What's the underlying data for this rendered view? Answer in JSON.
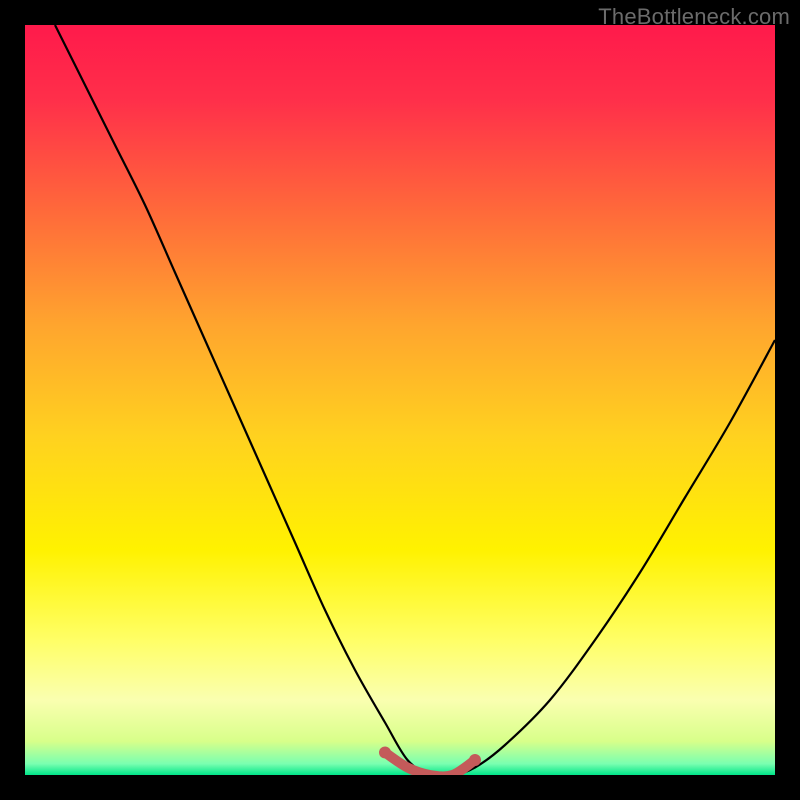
{
  "watermark": "TheBottleneck.com",
  "chart_data": {
    "type": "line",
    "title": "",
    "xlabel": "",
    "ylabel": "",
    "xlim": [
      0,
      100
    ],
    "ylim": [
      0,
      100
    ],
    "gradient_stops": [
      {
        "offset": 0.0,
        "color": "#ff1a4b"
      },
      {
        "offset": 0.1,
        "color": "#ff2f4a"
      },
      {
        "offset": 0.25,
        "color": "#ff6a3a"
      },
      {
        "offset": 0.4,
        "color": "#ffa52e"
      },
      {
        "offset": 0.55,
        "color": "#ffd21f"
      },
      {
        "offset": 0.7,
        "color": "#fff200"
      },
      {
        "offset": 0.82,
        "color": "#ffff66"
      },
      {
        "offset": 0.9,
        "color": "#faffb0"
      },
      {
        "offset": 0.955,
        "color": "#d8ff8a"
      },
      {
        "offset": 0.985,
        "color": "#7affb0"
      },
      {
        "offset": 1.0,
        "color": "#00e589"
      }
    ],
    "series": [
      {
        "name": "bottleneck-curve",
        "x": [
          4,
          8,
          12,
          16,
          20,
          24,
          28,
          32,
          36,
          40,
          44,
          48,
          51,
          54,
          57,
          60,
          64,
          70,
          76,
          82,
          88,
          94,
          100
        ],
        "y": [
          100,
          92,
          84,
          76,
          67,
          58,
          49,
          40,
          31,
          22,
          14,
          7,
          2,
          0,
          0,
          1,
          4,
          10,
          18,
          27,
          37,
          47,
          58
        ]
      }
    ],
    "highlight": {
      "color": "#c45a5a",
      "x": [
        48,
        51,
        54,
        57,
        60
      ],
      "y": [
        3,
        1,
        0,
        0,
        2
      ]
    }
  }
}
